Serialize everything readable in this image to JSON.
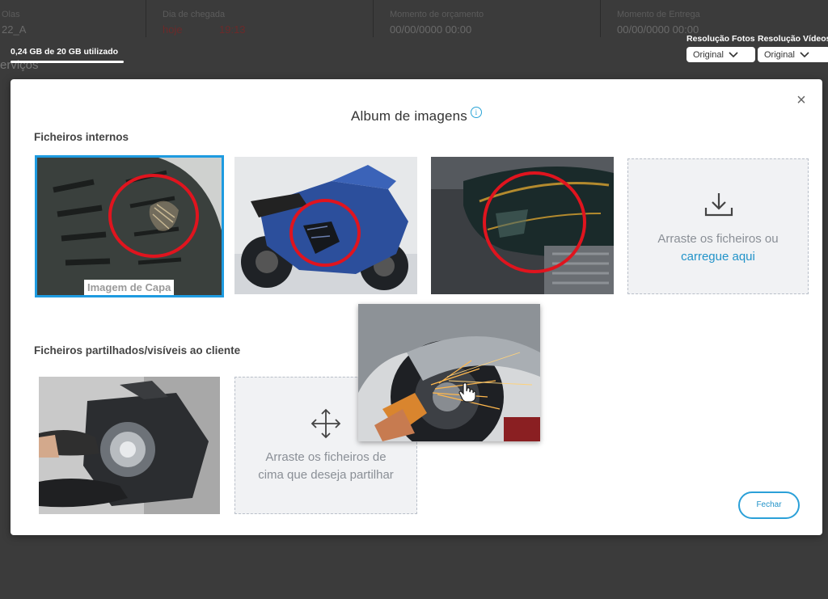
{
  "background": {
    "columns": [
      {
        "label": "Olas",
        "value": "22_A"
      },
      {
        "label": "Dia de chegada",
        "value": "hoje",
        "time": "19:13"
      },
      {
        "label": "Momento de orçamento",
        "value": "00/00/0000 00:00"
      },
      {
        "label": "Momento de Entrega",
        "value": "00/00/0000 00:00"
      }
    ],
    "left_fragment": "erviços",
    "storage_text": "0,24 GB de 20 GB utilizado",
    "photo_resolution": {
      "label": "Resolução Fotos",
      "value": "Original"
    },
    "video_resolution": {
      "label": "Resolução Vídeos",
      "value": "Original"
    }
  },
  "modal": {
    "title": "Album de imagens",
    "info_glyph": "i",
    "close_glyph": "×",
    "internal_section_label": "Ficheiros internos",
    "cover_label": "Imagem de Capa",
    "upload_zone": {
      "text": "Arraste os ficheiros ou",
      "link": "carregue aqui"
    },
    "shared_section_label": "Ficheiros partilhados/visíveis ao cliente",
    "share_zone": {
      "line1": "Arraste os ficheiros de",
      "line2": "cima que deseja partilhar"
    },
    "close_button": "Fechar"
  },
  "icons": {
    "info": "info-icon",
    "close": "close-icon",
    "upload": "download-tray-icon",
    "move": "move-arrows-icon",
    "chevron": "chevron-down-icon",
    "cursor": "hand-cursor-icon"
  },
  "colors": {
    "accent": "#1e9be0",
    "link": "#2293c9",
    "annotation_circle": "#e0141e"
  }
}
